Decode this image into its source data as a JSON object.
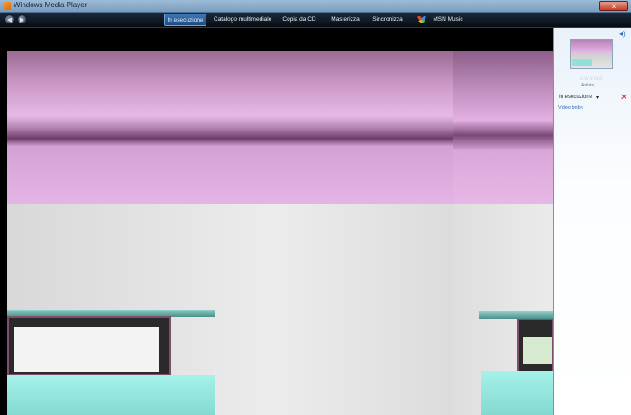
{
  "window": {
    "title": "Windows Media Player",
    "close_label": "x"
  },
  "nav": {
    "back_arrow": "◀",
    "forward_arrow": "▶",
    "tabs": [
      {
        "label": "In esecuzione",
        "active": true
      },
      {
        "label": "Catalogo multimediale",
        "active": false
      },
      {
        "label": "Copia da CD",
        "active": false
      },
      {
        "label": "Masterizza",
        "active": false
      },
      {
        "label": "Sincronizza",
        "active": false
      },
      {
        "label": "MSN Music",
        "active": false
      }
    ]
  },
  "panel": {
    "stars": "☆☆☆☆☆",
    "artist": "Artista",
    "playlist_label": "In esecuzione",
    "dropdown_arrow": "▾",
    "remove_icon": "✕",
    "item_link": "Video bnbh"
  },
  "icons": {
    "title": "media-player-icon",
    "speaker": "speaker-icon",
    "remove": "close-icon"
  },
  "colors": {
    "accent": "#2f6fb5",
    "video_purple": "#e6b9e6",
    "video_teal": "#92e0d8"
  }
}
